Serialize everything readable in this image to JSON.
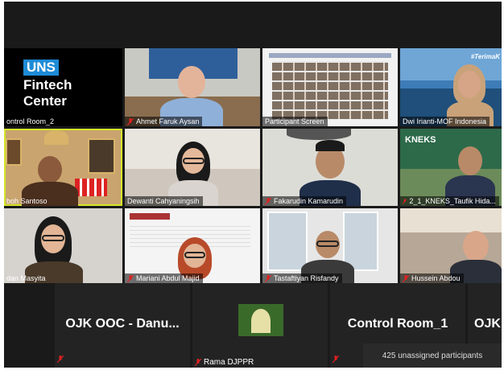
{
  "tiles": [
    {
      "name": "ontrol Room_2",
      "brand": [
        "UNS",
        "Fintech",
        "Center"
      ]
    },
    {
      "name": "Ahmet Faruk Aysan"
    },
    {
      "name": "Participant Screen"
    },
    {
      "name": "Dwi Irianti-MOF Indonesia",
      "banner": "#TerimaK"
    },
    {
      "name": "boh Santoso"
    },
    {
      "name": "Dewanti Cahyaningsih"
    },
    {
      "name": "Fakarudin Kamarudin"
    },
    {
      "name": "2_1_KNEKS_Taufik Hida...",
      "logo": "KNEKS"
    },
    {
      "name": "dan Masyita"
    },
    {
      "name": "Mariani Abdul Majid"
    },
    {
      "name": "Tastaftiyan Risfandy"
    },
    {
      "name": "Hussein Abdou"
    }
  ],
  "bottom": {
    "t1": "OJK OOC - Danu...",
    "t2_name": "Rama DJPPR",
    "t3": "Control Room_1",
    "t4": "OJK",
    "unassigned": "425 unassigned participants"
  },
  "colors": {
    "background": "#1a1a1a",
    "active_speaker": "#d4e62a",
    "muted_mic": "#e02020"
  }
}
